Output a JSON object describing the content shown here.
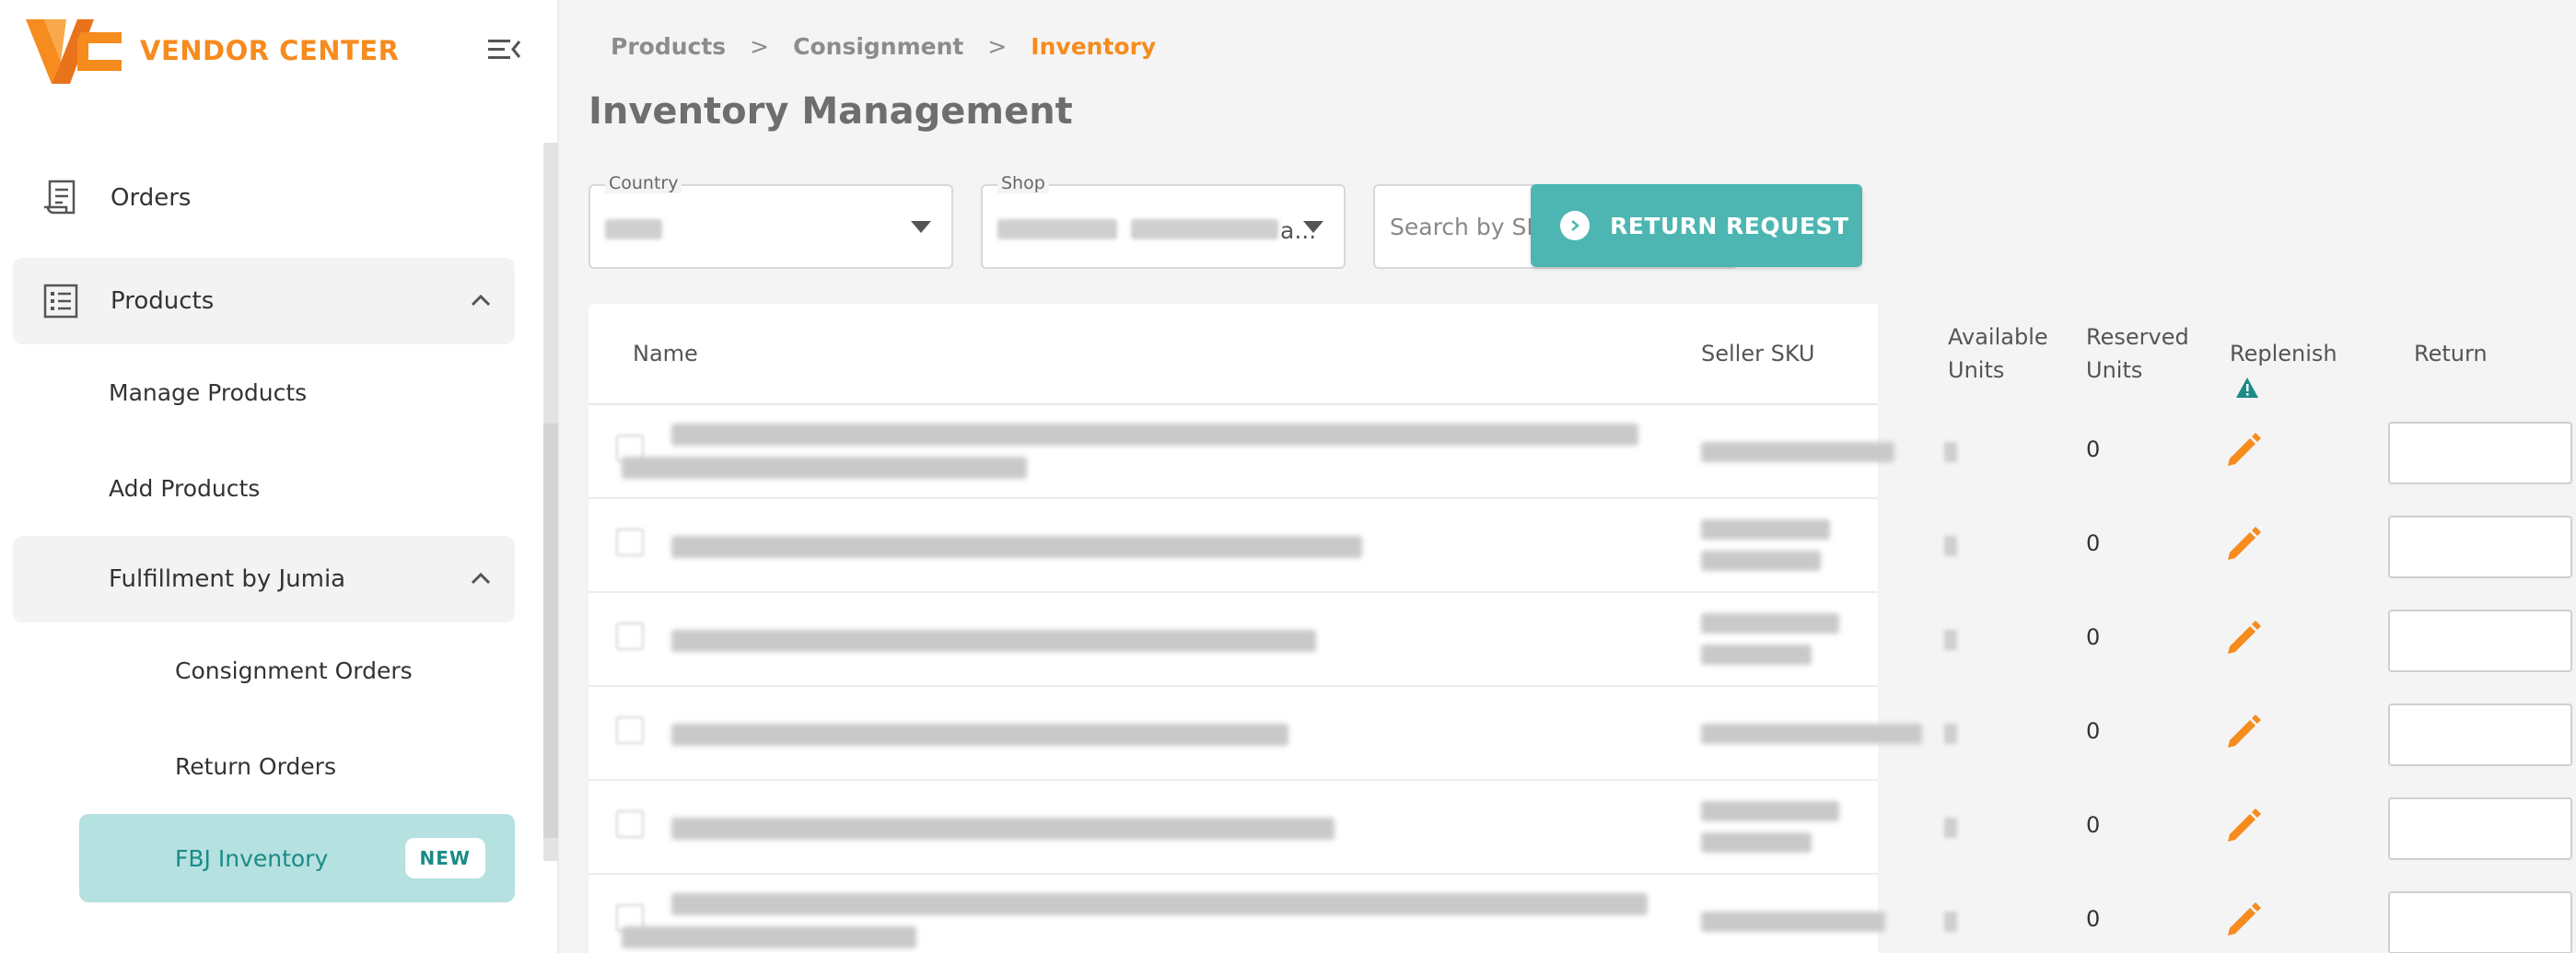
{
  "app": {
    "title": "VENDOR CENTER"
  },
  "colors": {
    "brand": "#f68b1e",
    "accent": "#4db6b2",
    "active_bg": "#b5e1e0",
    "active_text": "#1c8b87",
    "warning": "#1c8b87"
  },
  "sidebar": {
    "items": [
      {
        "label": "Orders",
        "icon": "receipt-icon"
      },
      {
        "label": "Products",
        "icon": "list-icon",
        "expanded": true
      }
    ],
    "products_sub": [
      {
        "label": "Manage Products"
      },
      {
        "label": "Add Products"
      }
    ],
    "fulfillment": {
      "label": "Fulfillment by Jumia",
      "expanded": true
    },
    "fulfillment_sub": [
      {
        "label": "Consignment Orders"
      },
      {
        "label": "Return Orders"
      }
    ],
    "active_item": {
      "label": "FBJ Inventory",
      "badge": "NEW"
    }
  },
  "breadcrumb": [
    "Products",
    "Consignment",
    "Inventory"
  ],
  "page": {
    "title": "Inventory Management"
  },
  "filters": {
    "country_label": "Country",
    "shop_label": "Shop",
    "shop_suffix": "a...",
    "search_placeholder": "Search by SKU"
  },
  "actions": {
    "return_request": "RETURN REQUEST"
  },
  "table": {
    "headers": {
      "name": "Name",
      "seller_sku": "Seller SKU",
      "available_1": "Available",
      "available_2": "Units",
      "reserved_1": "Reserved",
      "reserved_2": "Units",
      "replenish": "Replenish",
      "return": "Return"
    },
    "rows": [
      {
        "reserved": "0"
      },
      {
        "reserved": "0"
      },
      {
        "reserved": "0"
      },
      {
        "reserved": "0"
      },
      {
        "reserved": "0"
      },
      {
        "reserved": "0"
      }
    ]
  }
}
